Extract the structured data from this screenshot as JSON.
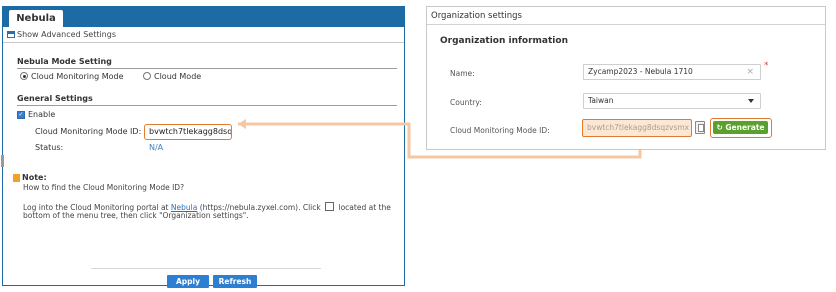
{
  "device_gui": {
    "tab_title": "Nebula",
    "advanced_link": "Show Advanced Settings",
    "mode_section": {
      "title": "Nebula Mode Setting",
      "options": [
        "Cloud Monitoring Mode",
        "Cloud Mode"
      ],
      "selected": "Cloud Monitoring Mode"
    },
    "general_section": {
      "title": "General Settings",
      "enable_label": "Enable",
      "enable_checked": true,
      "id_label": "Cloud Monitoring Mode ID:",
      "id_value": "bvwtch7tlekagg8dsq",
      "status_label": "Status:",
      "status_value": "N/A"
    },
    "note": {
      "title": "Note:",
      "line1": "How to find the Cloud Monitoring Mode ID?",
      "line2_prefix": "Log into the Cloud Monitoring portal at",
      "line2_link": "Nebula",
      "line2_suffix": "(https://nebula.zyxel.com). Click",
      "line2_end": "located at the",
      "line3": "bottom of the menu tree, then click \"Organization settings\"."
    },
    "buttons": {
      "apply": "Apply",
      "refresh": "Refresh"
    }
  },
  "nebula_portal": {
    "header": "Organization settings",
    "section_title": "Organization information",
    "name_label": "Name:",
    "name_value": "Zycamp2023 - Nebula 1710",
    "country_label": "Country:",
    "country_value": "Taiwan",
    "id_label": "Cloud Monitoring Mode ID:",
    "id_value": "bvwtch7tlekagg8dsqzvsmx",
    "generate_label": "Generate"
  },
  "colors": {
    "highlight": "#e07b2f",
    "nav_blue": "#1c6ba4",
    "button_blue": "#2e7fd1",
    "generate_green": "#5aa02c"
  }
}
